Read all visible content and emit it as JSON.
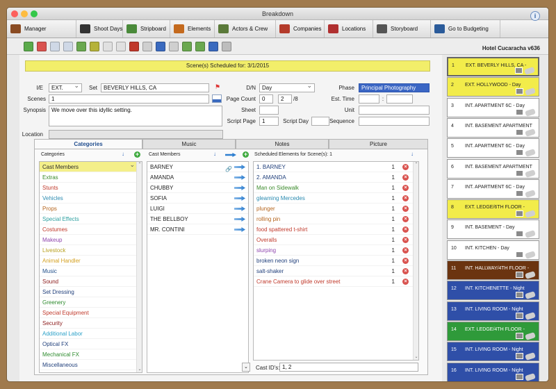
{
  "window": {
    "title": "Breakdown"
  },
  "nav": [
    {
      "label": "Manager",
      "icon": "briefcase-icon",
      "color": "#8a4b22",
      "width": 100
    },
    {
      "label": "Shoot Days",
      "icon": "shoot-days-icon",
      "color": "#333333",
      "width": 67
    },
    {
      "label": "Stripboard",
      "icon": "stripboard-icon",
      "color": "#4a8a3a",
      "width": 68
    },
    {
      "label": "Elements",
      "icon": "gun-icon",
      "color": "#c46a1e",
      "width": 64
    },
    {
      "label": "Actors & Crew",
      "icon": "actors-icon",
      "color": "#5b7a3a",
      "width": 88
    },
    {
      "label": "Companies",
      "icon": "companies-icon",
      "color": "#b43b2b",
      "width": 70
    },
    {
      "label": "Locations",
      "icon": "locations-icon",
      "color": "#b03030",
      "width": 70
    },
    {
      "label": "Storyboard",
      "icon": "storyboard-icon",
      "color": "#555555",
      "width": 83
    },
    {
      "label": "Go to Budgeting",
      "icon": "budgeting-icon",
      "color": "#2b5b9a",
      "width": 100
    }
  ],
  "toolbar": {
    "project_name": "Hotel Cucaracha v636"
  },
  "banner": "Scene(s) Scheduled for: 3/1/2015",
  "form": {
    "ie_label": "I/E",
    "ie_value": "EXT.",
    "set_label": "Set",
    "set_value": "BEVERLY HILLS, CA",
    "dn_label": "D/N",
    "dn_value": "Day",
    "phase_label": "Phase",
    "phase_value": "Principal Photography",
    "scenes_label": "Scenes",
    "scenes_value": "1",
    "pagecount_label": "Page Count",
    "pagecount_whole": "0",
    "pagecount_num": "2",
    "pagecount_denom": "/8",
    "esttime_label": "Est. Time",
    "esttime_sep": ":",
    "synopsis_label": "Synopsis",
    "synopsis_value": "We move over this idyllic setting.",
    "sheet_label": "Sheet",
    "unit_label": "Unit",
    "scriptpage_label": "Script Page",
    "scriptpage_value": "1",
    "scriptday_label": "Script Day",
    "sequence_label": "Sequence",
    "location_label": "Location"
  },
  "tabs": [
    "Categories",
    "Music",
    "Notes",
    "Picture"
  ],
  "categories": {
    "header": "Categories",
    "items": [
      {
        "label": "Cast Members",
        "color": "#2b2b2b"
      },
      {
        "label": "Extras",
        "color": "#3a8a2a"
      },
      {
        "label": "Stunts",
        "color": "#c0392b"
      },
      {
        "label": "Vehicles",
        "color": "#2a8ab0"
      },
      {
        "label": "Props",
        "color": "#b5651d"
      },
      {
        "label": "Special Effects",
        "color": "#2ea0a0"
      },
      {
        "label": "Costumes",
        "color": "#c0392b"
      },
      {
        "label": "Makeup",
        "color": "#8e44ad"
      },
      {
        "label": "Livestock",
        "color": "#b8a020"
      },
      {
        "label": "Animal Handler",
        "color": "#d4a020"
      },
      {
        "label": "Music",
        "color": "#1f4e8a"
      },
      {
        "label": "Sound",
        "color": "#8b1a1a"
      },
      {
        "label": "Set Dressing",
        "color": "#1f3e7a"
      },
      {
        "label": "Greenery",
        "color": "#2e8b2e"
      },
      {
        "label": "Special Equipment",
        "color": "#c0392b"
      },
      {
        "label": "Security",
        "color": "#8b1a1a"
      },
      {
        "label": "Additional Labor",
        "color": "#2aa0c8"
      },
      {
        "label": "Optical FX",
        "color": "#1f3e7a"
      },
      {
        "label": "Mechanical FX",
        "color": "#2e8b2e"
      },
      {
        "label": "Miscellaneous",
        "color": "#1f3e7a"
      }
    ]
  },
  "cast": {
    "header": "Cast Members",
    "items": [
      "BARNEY",
      "AMANDA",
      "CHUBBY",
      "SOFIA",
      "LUIGI",
      "THE BELLBOY",
      "MR. CONTINI"
    ]
  },
  "scheduled": {
    "header": "Scheduled Elements for Scene(s): 1",
    "items": [
      {
        "label": "1. BARNEY",
        "qty": "1",
        "color": "#1f3e7a"
      },
      {
        "label": "2. AMANDA",
        "qty": "1",
        "color": "#1f3e7a"
      },
      {
        "label": "Man on Sidewalk",
        "qty": "1",
        "color": "#3a8a2a"
      },
      {
        "label": "gleaming Mercedes",
        "qty": "1",
        "color": "#2a8ab0"
      },
      {
        "label": "plunger",
        "qty": "1",
        "color": "#b5651d"
      },
      {
        "label": "rolling pin",
        "qty": "1",
        "color": "#b5651d"
      },
      {
        "label": "food spattered t-shirt",
        "qty": "1",
        "color": "#c0392b"
      },
      {
        "label": "Overalls",
        "qty": "1",
        "color": "#c0392b"
      },
      {
        "label": "slurping",
        "qty": "1",
        "color": "#8e44ad"
      },
      {
        "label": "broken neon sign",
        "qty": "1",
        "color": "#1f3e7a"
      },
      {
        "label": "salt-shaker",
        "qty": "1",
        "color": "#1f3e7a"
      },
      {
        "label": "Crane Camera to glide over street",
        "qty": "1",
        "color": "#c0392b"
      }
    ],
    "cast_ids_label": "Cast ID's:",
    "cast_ids_value": "1, 2"
  },
  "strips": [
    {
      "num": "1",
      "text": "EXT. BEVERLY HILLS, CA  -",
      "bg": "#f2ec4a",
      "fg": "#222222"
    },
    {
      "num": "2",
      "text": "EXT. HOLLYWOOD  - Day",
      "bg": "#f2ec4a",
      "fg": "#222222"
    },
    {
      "num": "3",
      "text": "INT. APARTMENT 6C  - Day",
      "bg": "#ffffff",
      "fg": "#222222"
    },
    {
      "num": "4",
      "text": "INT. BASEMENT APARTMENT",
      "bg": "#ffffff",
      "fg": "#222222"
    },
    {
      "num": "5",
      "text": "INT. APARTMENT 6C  - Day",
      "bg": "#ffffff",
      "fg": "#222222"
    },
    {
      "num": "6",
      "text": "INT. BASEMENT APARTMENT",
      "bg": "#ffffff",
      "fg": "#222222"
    },
    {
      "num": "7",
      "text": "INT. APARTMENT 6C  - Day",
      "bg": "#ffffff",
      "fg": "#222222"
    },
    {
      "num": "8",
      "text": "EXT. LEDGE/6TH FLOOR  -",
      "bg": "#f2ec4a",
      "fg": "#222222"
    },
    {
      "num": "9",
      "text": "INT. BASEMENT  - Day",
      "bg": "#ffffff",
      "fg": "#222222"
    },
    {
      "num": "10",
      "text": "INT. KITCHEN  - Day",
      "bg": "#ffffff",
      "fg": "#222222"
    },
    {
      "num": "11",
      "text": "INT. HALLWAY/4TH FLOOR  -",
      "bg": "#6b3410",
      "fg": "#ffffff"
    },
    {
      "num": "12",
      "text": "INT. KITCHENETTE  - Night",
      "bg": "#2f4fa8",
      "fg": "#ffffff"
    },
    {
      "num": "13",
      "text": "INT. LIVING ROOM  - Night",
      "bg": "#2f4fa8",
      "fg": "#ffffff"
    },
    {
      "num": "14",
      "text": "EXT. LEDGE/4TH FLOOR  -",
      "bg": "#2f9a3a",
      "fg": "#ffffff"
    },
    {
      "num": "15",
      "text": "INT. LIVING ROOM  - Night",
      "bg": "#2f4fa8",
      "fg": "#ffffff"
    },
    {
      "num": "16",
      "text": "INT. LIVING ROOM  - Night",
      "bg": "#2f4fa8",
      "fg": "#ffffff"
    }
  ],
  "toolbar_icons": [
    {
      "name": "new-scene-icon",
      "color": "#5aaa4a"
    },
    {
      "name": "delete-scene-icon",
      "color": "#d9534f"
    },
    {
      "name": "copy-scene-icon",
      "color": "#cfd8e6"
    },
    {
      "name": "duplicate-scene-icon",
      "color": "#cfd8e6"
    },
    {
      "name": "report-icon",
      "color": "#6aa84f"
    },
    {
      "name": "list-icon",
      "color": "#b5b23a"
    },
    {
      "name": "import-icon",
      "color": "#e0e0e0"
    },
    {
      "name": "export-icon",
      "color": "#e0e0e0"
    },
    {
      "name": "grid-icon",
      "color": "#c0392b"
    },
    {
      "name": "tag-icon",
      "color": "#cfcfcf"
    },
    {
      "name": "sort-icon",
      "color": "#3a6abf"
    },
    {
      "name": "erase-icon",
      "color": "#cfcfcf"
    },
    {
      "name": "link-icon",
      "color": "#6aa84f"
    },
    {
      "name": "add-link-icon",
      "color": "#6aa84f"
    },
    {
      "name": "refresh-icon",
      "color": "#3a6abf"
    },
    {
      "name": "box-icon",
      "color": "#bdbdbd"
    }
  ]
}
